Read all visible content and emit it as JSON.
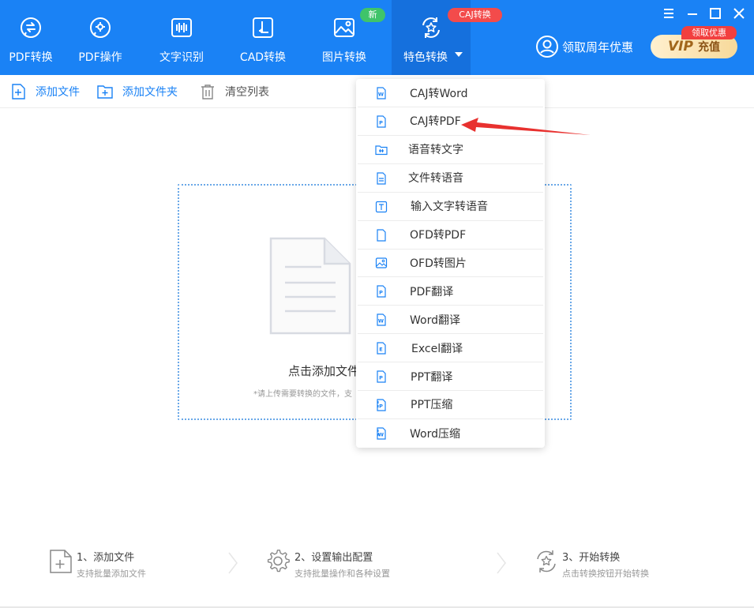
{
  "nav": {
    "items": [
      {
        "label": "PDF转换",
        "icon": "pdf-convert-icon"
      },
      {
        "label": "PDF操作",
        "icon": "pdf-operate-icon"
      },
      {
        "label": "文字识别",
        "icon": "ocr-icon"
      },
      {
        "label": "CAD转换",
        "icon": "cad-icon"
      },
      {
        "label": "图片转换",
        "icon": "image-icon"
      },
      {
        "label": "特色转换",
        "icon": "star-convert-icon"
      }
    ],
    "badge_new": "新",
    "badge_caj": "CAJ转换"
  },
  "header": {
    "account_label": "领取周年优惠",
    "vip_text": "VIP",
    "vip_action": "充值",
    "vip_tag": "领取优惠"
  },
  "toolbar": {
    "add_file": "添加文件",
    "add_folder": "添加文件夹",
    "clear_list": "清空列表"
  },
  "dropzone": {
    "title": "点击添加文件",
    "hint": "*请上传需要转换的文件，支"
  },
  "dropdown": {
    "items": [
      "CAJ转Word",
      "CAJ转PDF",
      "语音转文字",
      "文件转语音",
      "输入文字转语音",
      "OFD转PDF",
      "OFD转图片",
      "PDF翻译",
      "Word翻译",
      "Excel翻译",
      "PPT翻译",
      "PPT压缩",
      "Word压缩"
    ]
  },
  "steps": [
    {
      "title": "1、添加文件",
      "subtitle": "支持批量添加文件"
    },
    {
      "title": "2、设置输出配置",
      "subtitle": "支持批量操作和各种设置"
    },
    {
      "title": "3、开始转换",
      "subtitle": "点击转换按钮开始转换"
    }
  ],
  "colors": {
    "primary": "#1a82f5",
    "badge_green": "#3fc46a",
    "badge_red": "#f34b4b",
    "arrow_red": "#e8312f"
  }
}
